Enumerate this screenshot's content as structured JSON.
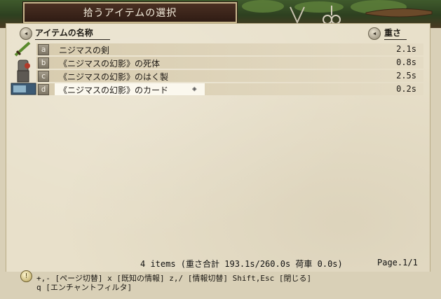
{
  "window": {
    "title": "拾うアイテムの選択"
  },
  "header": {
    "name_label": "アイテムの名称",
    "weight_label": "重さ"
  },
  "items": [
    {
      "key": "a",
      "name": "ニジマスの剣",
      "weight": "2.1s",
      "icon": "sword-icon"
    },
    {
      "key": "b",
      "name": "《ニジマスの幻影》の死体",
      "weight": "0.8s",
      "icon": "corpse-icon"
    },
    {
      "key": "c",
      "name": "《ニジマスの幻影》のはく製",
      "weight": "2.5s",
      "icon": "stuffed-fish-icon"
    },
    {
      "key": "d",
      "name": "《ニジマスの幻影》のカード",
      "weight": "0.2s",
      "icon": "card-icon",
      "selected": true
    }
  ],
  "footer": {
    "summary": "4 items  (重さ合計 193.1s/260.0s  荷車 0.0s)",
    "page": "Page.1/1"
  },
  "help": {
    "line1": "+,- [ページ切替]  x [既知の情報]  z,/ [情報切替]  Shift,Esc [閉じる]",
    "line2": "q [エンチャントフィルタ]"
  },
  "colors": {
    "panel": "#e8e0ca",
    "row": "#d8ccaf",
    "title_bg": "#2f1c14"
  }
}
